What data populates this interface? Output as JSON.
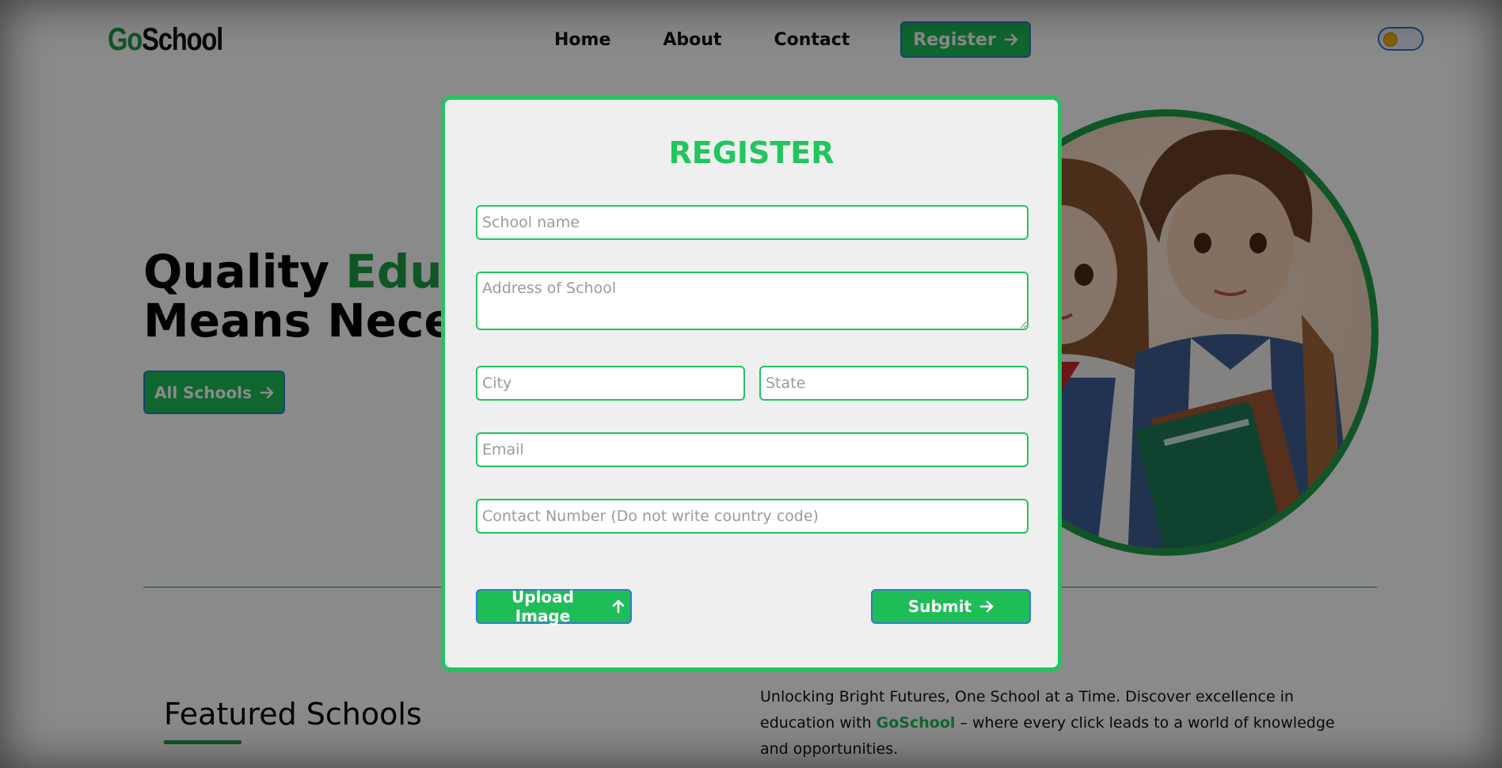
{
  "header": {
    "logo_part1": "Go",
    "logo_part2": "School",
    "nav": {
      "home": "Home",
      "about": "About",
      "contact": "Contact",
      "register": "Register"
    },
    "theme_toggle_icon": "sun-icon"
  },
  "hero": {
    "title_line1_start": "Quality ",
    "title_line1_highlight": "Educ",
    "title_line2": "Means Nece",
    "cta": "All Schools"
  },
  "featured": {
    "heading": "Featured Schools"
  },
  "tagline": {
    "text_before": "Unlocking Bright Futures, One School at a Time. Discover excellence in education with ",
    "brand": "GoSchool",
    "text_after": " – where every click leads to a world of knowledge and opportunities."
  },
  "modal": {
    "title": "REGISTER",
    "fields": {
      "school_name": "School name",
      "address": "Address of School",
      "city": "City",
      "state": "State",
      "email": "Email",
      "contact": "Contact Number (Do not write country code)"
    },
    "upload_label": "Upload Image",
    "submit_label": "Submit"
  },
  "colors": {
    "brand_green": "#1f9d46",
    "accent_green": "#22c55e",
    "button_border": "#2f7bd0"
  }
}
